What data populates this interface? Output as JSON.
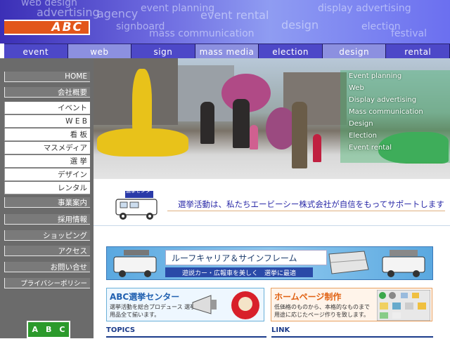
{
  "header": {
    "logo": "ABC",
    "bg_words": [
      "web design",
      "advertising",
      "agency",
      "event planning",
      "event rental",
      "display advertising",
      "signboard",
      "mass communication",
      "design",
      "election",
      "festival"
    ]
  },
  "nav": {
    "items": [
      "event",
      "web",
      "sign",
      "mass media",
      "election",
      "design",
      "rental"
    ]
  },
  "sidebar": {
    "items": [
      "HOME",
      "会社概要",
      "イベント",
      "W E B",
      "看 板",
      "マスメディア",
      "選 挙",
      "デザイン",
      "レンタル",
      "事業案内",
      "採用情報",
      "ショッピング",
      "アクセス",
      "お問い合せ",
      "プライバシーポリシー"
    ],
    "badge": [
      "A",
      "B",
      "C"
    ]
  },
  "photo": {
    "menu": [
      "Event planning",
      "Web",
      "Display advertising",
      "Mass communication",
      "Design",
      "Election",
      "Event rental"
    ]
  },
  "tagline": {
    "van_sign": "選挙センター",
    "text": "選挙活動は、私たちエービーシー株式会社が自信をもってサポートします"
  },
  "banner": {
    "title": "ルーフキャリア＆サインフレーム",
    "subtitle": "遊説カー・広報車を美しく　選挙に最適"
  },
  "cards": [
    {
      "title": "ABC選挙センター",
      "desc": "選挙活動を総合プロデュース 選挙用品全て揃います。"
    },
    {
      "title": "ホームページ制作",
      "desc": "低価格のものから、本格的なものまで 用途に応じたページ作りを致します。"
    }
  ],
  "sections": {
    "topics": "TOPICS",
    "link": "LINK"
  },
  "colors": {
    "header_bg": "#4d48c8",
    "logo_bg": "#e2561a",
    "sidebar_bg": "#6b6b6b",
    "badge_bg": "#2c9a2c"
  }
}
